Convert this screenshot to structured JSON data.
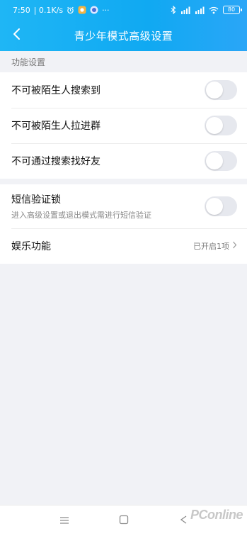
{
  "status_bar": {
    "time": "7:50",
    "speed": "| 0.1K/s",
    "more": "···",
    "battery": "80",
    "icons": [
      "alarm-icon",
      "app-notification-icon",
      "vpn-icon",
      "bluetooth-icon",
      "signal-icon",
      "signal-icon-2",
      "wifi-icon",
      "battery-icon"
    ]
  },
  "header": {
    "title": "青少年模式高级设置",
    "back_icon": "chevron-left-icon"
  },
  "sections": {
    "features_label": "功能设置"
  },
  "settings": {
    "no_search_by_stranger": "不可被陌生人搜索到",
    "no_pulled_into_group": "不可被陌生人拉进群",
    "no_find_by_search": "不可通过搜索找好友",
    "sms_lock_title": "短信验证锁",
    "sms_lock_desc": "进入高级设置或退出模式需进行短信验证",
    "entertainment_title": "娱乐功能",
    "entertainment_value": "已开启1项"
  },
  "toggles": {
    "no_search_by_stranger": false,
    "no_pulled_into_group": false,
    "no_find_by_search": false,
    "sms_lock": false
  },
  "bottom_nav": {
    "icons": [
      "menu-icon",
      "home-square-icon",
      "back-triangle-icon"
    ]
  },
  "watermark": {
    "text": "PConline"
  },
  "colors": {
    "header_gradient_start": "#1fb6f5",
    "header_gradient_end": "#2aa6f7",
    "toggle_off": "#e6e8ee",
    "page_bg": "#f1f2f6"
  }
}
